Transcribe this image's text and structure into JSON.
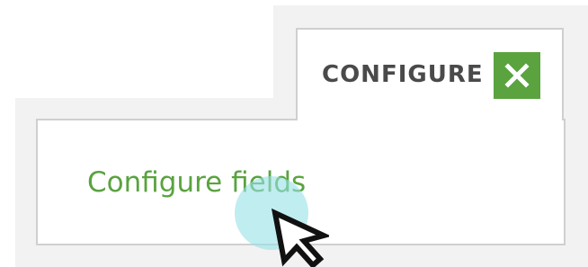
{
  "dialog": {
    "title": "CONFIGURE",
    "close_icon": "close-icon",
    "action_link": "Configure fields"
  },
  "colors": {
    "accent": "#5aa33f",
    "title_text": "#4a4a4a",
    "panel_border": "#cfcfcf",
    "band_background": "#f2f2f2",
    "click_halo": "#96e1e6"
  },
  "pointer": {
    "icon": "arrow-cursor-icon",
    "state": "clicking"
  }
}
